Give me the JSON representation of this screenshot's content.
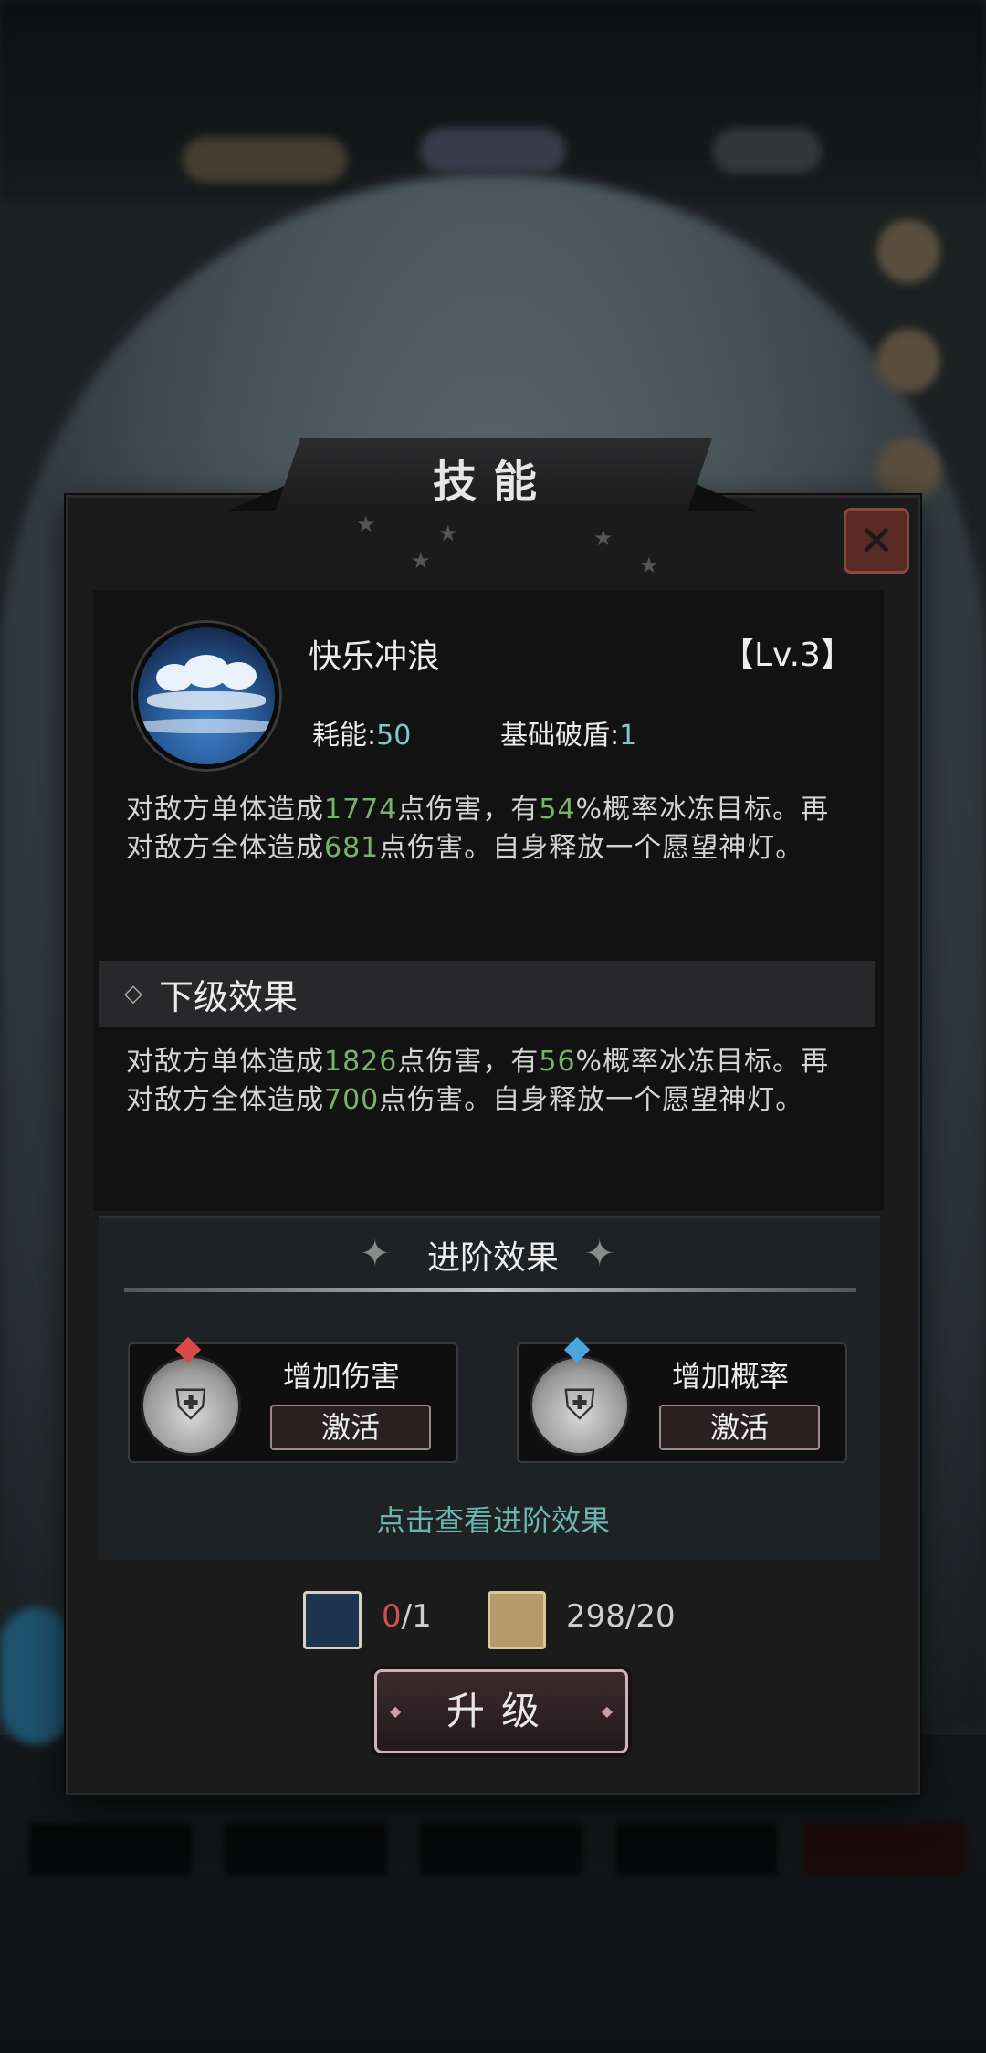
{
  "dialog": {
    "title": "技能",
    "close_icon": "close-icon"
  },
  "skill": {
    "name": "快乐冲浪",
    "level": "【Lv.3】",
    "cost_label": "耗能:",
    "cost_value": "50",
    "shield_label": "基础破盾:",
    "shield_value": "1",
    "desc_line1": {
      "a": "对敌方单体造成",
      "dmg": "1774",
      "b": "点伤害，有",
      "pct": "54",
      "c": "%概率冰冻目标。再"
    },
    "desc_line2": {
      "a": "对敌方全体造成",
      "dmg": "681",
      "b": "点伤害。自身释放一个愿望神灯。"
    }
  },
  "next": {
    "title": "下级效果",
    "desc_line1": {
      "a": "对敌方单体造成",
      "dmg": "1826",
      "b": "点伤害，有",
      "pct": "56",
      "c": "%概率冰冻目标。再"
    },
    "desc_line2": {
      "a": "对敌方全体造成",
      "dmg": "700",
      "b": "点伤害。自身释放一个愿望神灯。"
    }
  },
  "advanced": {
    "title": "进阶效果",
    "cards": [
      {
        "name": "增加伤害",
        "action": "激活",
        "gem_color": "#d94a4a"
      },
      {
        "name": "增加概率",
        "action": "激活",
        "gem_color": "#4aa6e0"
      }
    ],
    "view_link": "点击查看进阶效果"
  },
  "costs": {
    "book_value": "0",
    "book_total": "/1",
    "scroll_text": "298/20"
  },
  "upgrade_label": "升级",
  "colors": {
    "accent_teal": "#6bb5b0",
    "value_green": "#78b26a",
    "stat_cyan": "#7ec8c8",
    "warn_red": "#d05050"
  }
}
